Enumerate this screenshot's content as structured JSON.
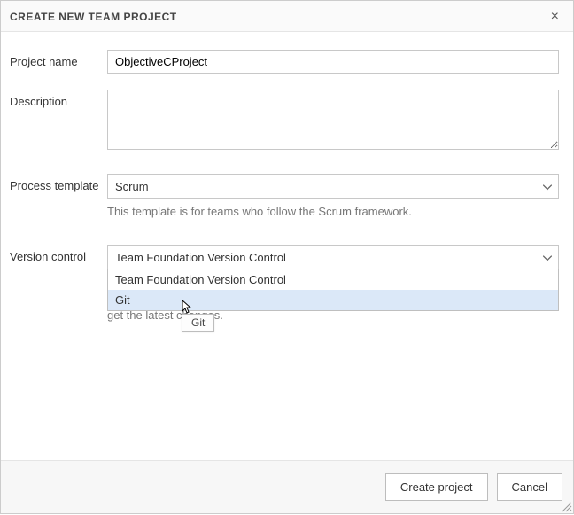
{
  "dialog": {
    "title": "CREATE NEW TEAM PROJECT"
  },
  "labels": {
    "project_name": "Project name",
    "description": "Description",
    "process_template": "Process template",
    "version_control": "Version control"
  },
  "fields": {
    "project_name_value": "ObjectiveCProject",
    "description_value": "",
    "process_template_selected": "Scrum",
    "process_template_help": "This template is for teams who follow the Scrum framework.",
    "version_control_selected": "Team Foundation Version Control",
    "version_control_options": {
      "0": "Team Foundation Version Control",
      "1": "Git"
    },
    "version_control_help_partial": "get the latest changes."
  },
  "tooltip": "Git",
  "buttons": {
    "create": "Create project",
    "cancel": "Cancel"
  }
}
